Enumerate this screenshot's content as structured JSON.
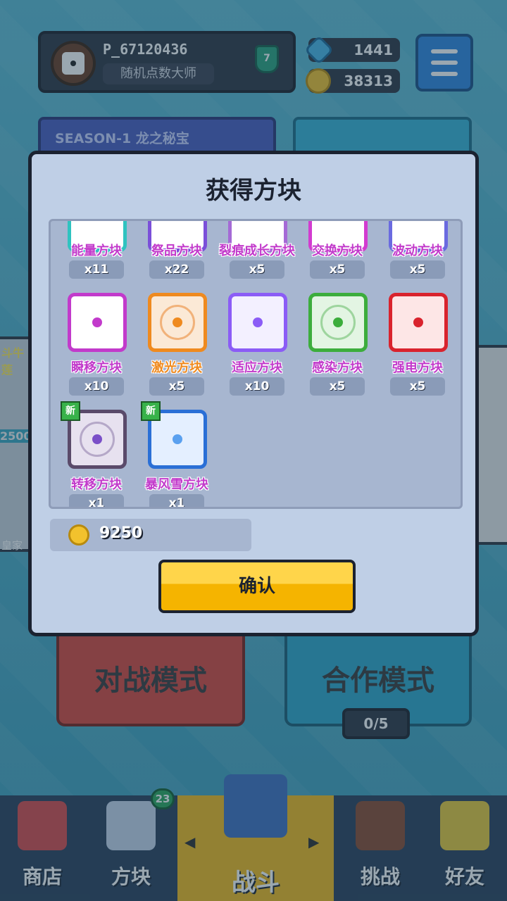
{
  "player": {
    "name": "P_67120436",
    "title": "随机点数大师",
    "rank": "7"
  },
  "currency": {
    "gems": "1441",
    "gold": "38313"
  },
  "season": {
    "label": "SEASON-1 龙之秘宝"
  },
  "side": {
    "left_top": "斗牛莲",
    "left_mid": "2500",
    "left_bottom": "皇家"
  },
  "modes": {
    "battle": "对战模式",
    "coop": "合作模式",
    "coop_count": "0/5"
  },
  "nav": {
    "shop": "商店",
    "blocks": "方块",
    "battle": "战斗",
    "challenge": "挑战",
    "friends": "好友",
    "blocks_badge": "23"
  },
  "modal": {
    "title": "获得方块",
    "coins": "9250",
    "confirm": "确认",
    "new_tag": "新"
  },
  "blocks": [
    {
      "name": "能量方块",
      "count": "x11",
      "color": "#2fc3c0"
    },
    {
      "name": "祭品方块",
      "count": "x22",
      "color": "#7b4fd9"
    },
    {
      "name": "裂痕成长方块",
      "count": "x5",
      "color": "#a56ad6"
    },
    {
      "name": "交换方块",
      "count": "x5",
      "color": "#d33bd0"
    },
    {
      "name": "波动方块",
      "count": "x5",
      "color": "#6a6ae0"
    },
    {
      "name": "瞬移方块",
      "count": "x10",
      "color": "#c23acb"
    },
    {
      "name": "激光方块",
      "count": "x5",
      "color": "#ef8a1f"
    },
    {
      "name": "适应方块",
      "count": "x10",
      "color": "#8b5cf6"
    },
    {
      "name": "感染方块",
      "count": "x5",
      "color": "#3cad3c"
    },
    {
      "name": "强电方块",
      "count": "x5",
      "color": "#d9232d"
    },
    {
      "name": "转移方块",
      "count": "x1",
      "color": "#7a4fc8"
    },
    {
      "name": "暴风雪方块",
      "count": "x1",
      "color": "#2a6fd6"
    }
  ]
}
